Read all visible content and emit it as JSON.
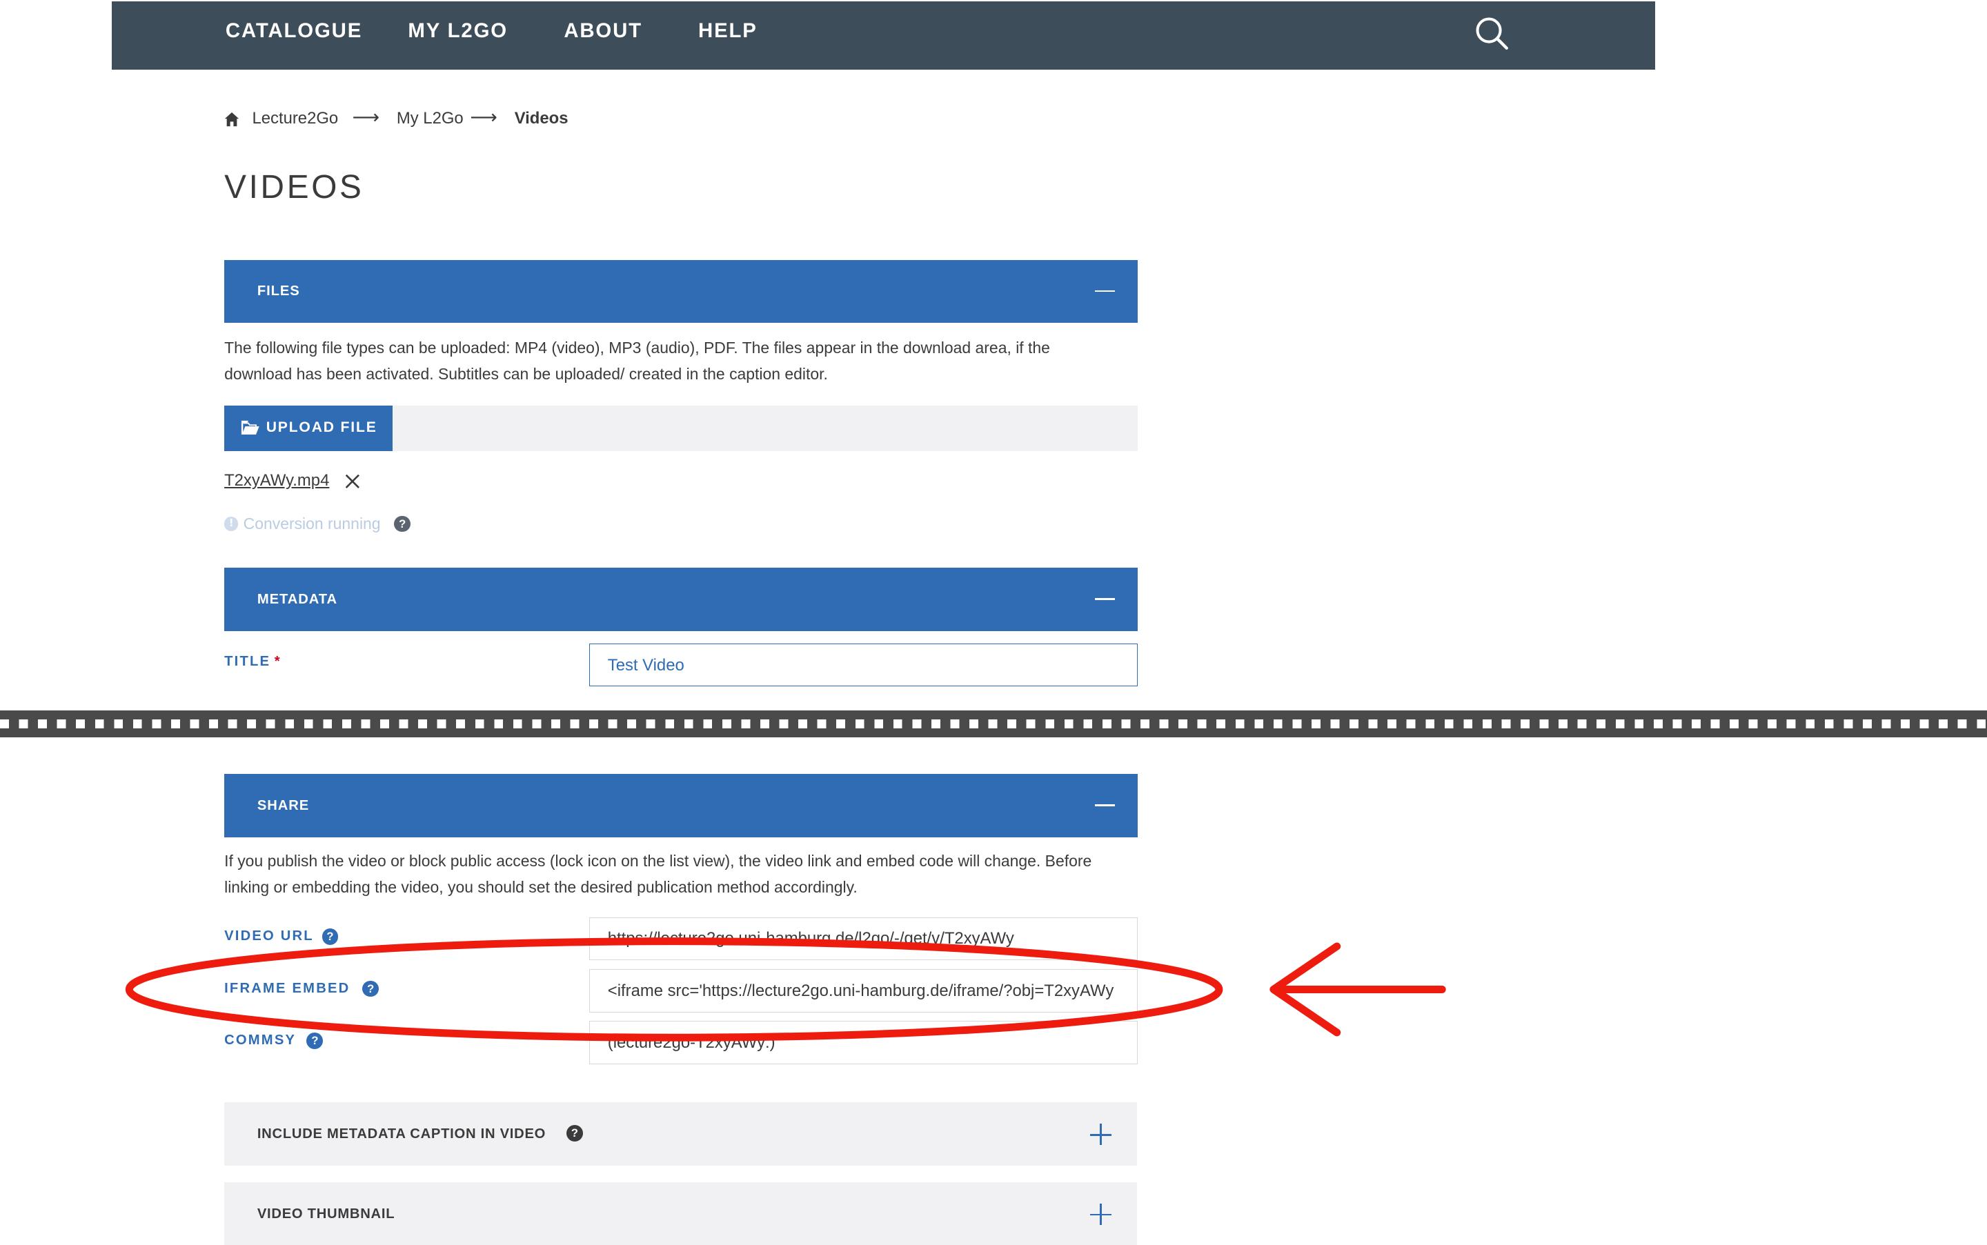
{
  "nav": {
    "items": [
      "CATALOGUE",
      "MY L2GO",
      "ABOUT",
      "HELP"
    ],
    "search_icon": "search-icon"
  },
  "breadcrumb": {
    "home_icon": "home-icon",
    "items": [
      "Lecture2Go",
      "My L2Go",
      "Videos"
    ],
    "separator": "⟶"
  },
  "page_title": "VIDEOS",
  "files": {
    "header": "FILES",
    "description": "The following file types can be uploaded: MP4 (video), MP3 (audio), PDF. The files appear in the download area, if the download has been activated. Subtitles can be uploaded/ created in the caption editor.",
    "upload_label": "UPLOAD FILE",
    "file_name": "T2xyAWy.mp4",
    "status": "Conversion running",
    "status_icon": "!",
    "help_icon": "?"
  },
  "metadata": {
    "header": "METADATA",
    "title_label": "TITLE",
    "required_marker": "*",
    "title_value": "Test Video"
  },
  "share": {
    "header": "SHARE",
    "description": "If you publish the video or block public access (lock icon on the list view), the video link and embed code will change. Before linking or embedding the video, you should set the desired publication method accordingly.",
    "video_url_label": "VIDEO URL",
    "video_url_value": "https://lecture2go.uni-hamburg.de/l2go/-/get/v/T2xyAWy",
    "iframe_label": "IFRAME EMBED",
    "iframe_value": "<iframe src='https://lecture2go.uni-hamburg.de/iframe/?obj=T2xyAWy",
    "commsy_label": "COMMSY",
    "commsy_value": "(lecture2go-T2xyAWy:)",
    "help_icon": "?"
  },
  "collapsed_sections": {
    "caption": "INCLUDE METADATA CAPTION IN VIDEO",
    "thumbnail": "VIDEO THUMBNAIL",
    "help_icon": "?"
  },
  "colors": {
    "nav_bg": "#3d4d5a",
    "accent": "#2f6cb4",
    "annotation": "#ee1c0f"
  }
}
